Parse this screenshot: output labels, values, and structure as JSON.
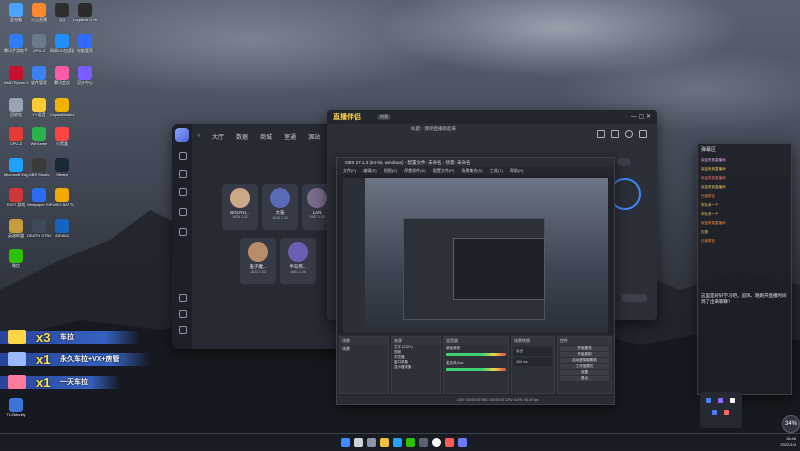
{
  "desktop_icons": [
    {
      "label": "此电脑",
      "color": "#4aa3ff"
    },
    {
      "label": "火山直播",
      "color": "#ff8a2b"
    },
    {
      "label": "QQ",
      "color": "#2f2f2f"
    },
    {
      "label": "Logitech G HUB",
      "color": "#2b2b2b"
    },
    {
      "label": "腾讯手游助手",
      "color": "#2e7cf6"
    },
    {
      "label": "GPU-Z",
      "color": "#6b7a8a"
    },
    {
      "label": "网易UU加速器",
      "color": "#1f8fff"
    },
    {
      "label": "电脑管家",
      "color": "#2f6bff"
    },
    {
      "label": "AMD Ryzen Master",
      "color": "#c8102e"
    },
    {
      "label": "软件管家",
      "color": "#3c82f6"
    },
    {
      "label": "腾讯会议",
      "color": "#ff5aa8"
    },
    {
      "label": "设计中心",
      "color": "#7b5cff"
    },
    {
      "label": "回收站",
      "color": "#9aa4b1"
    },
    {
      "label": "YY语音",
      "color": "#ffcc33"
    },
    {
      "label": "CrystalDiskInfo",
      "color": "#f0b400"
    },
    {
      "label": "CPU-Z",
      "color": "#e53935"
    },
    {
      "label": "WeGame",
      "color": "#2bb34b"
    },
    {
      "label": "小黑盒",
      "color": "#ff4444"
    },
    {
      "label": "Microsoft Edge",
      "color": "#1fa3ff"
    },
    {
      "label": "OBS Studio",
      "color": "#3a3a3a"
    },
    {
      "label": "Steam",
      "color": "#1b2838"
    },
    {
      "label": "RIOT 游戏",
      "color": "#d13639"
    },
    {
      "label": "Wallpaper Engine",
      "color": "#2a6df4"
    },
    {
      "label": "PUBG BATTLEGROUNDS",
      "color": "#f2a900"
    },
    {
      "label": "英雄联盟",
      "color": "#c89b3c"
    },
    {
      "label": "DEATH STRANDING",
      "color": "#3c4a5a"
    },
    {
      "label": "AIDA64",
      "color": "#1565c0"
    },
    {
      "label": "微信",
      "color": "#2dc100"
    },
    {
      "label": "TLSMunity",
      "color": "#3f74d9"
    }
  ],
  "app1": {
    "nav": [
      "大厅",
      "数据",
      "商城",
      "室通",
      "源站"
    ],
    "cards": [
      {
        "name": "BOUYU...",
        "stats": "1926 1.42"
      },
      {
        "name": "大笼",
        "stats": "1816 1.33"
      },
      {
        "name": "LAN",
        "stats": "1902 1.32"
      },
      {
        "name": "鬼子魔...",
        "stats": "1623 1.33"
      },
      {
        "name": "半岛熊...",
        "stats": "1681 1.26"
      }
    ]
  },
  "app2": {
    "brand": "直播伴侣",
    "version": "内测",
    "live_title": "标题：我吧直播跑起来"
  },
  "obs": {
    "title": "OBS 27.1.3 (64-bit, windows) - 配置文件: 未命名 - 场景: 未命名",
    "menu": [
      "文件(F)",
      "编辑(E)",
      "视图(V)",
      "停靠部件(D)",
      "配置文件(P)",
      "场景集合(S)",
      "工具(T)",
      "帮助(H)"
    ],
    "docks": [
      "场景",
      "来源",
      "混音器",
      "场景转换",
      "控件"
    ],
    "scene": "场景",
    "sources": [
      "文字 (GDI+)",
      "视频",
      "浏览器",
      "窗口采集",
      "显示器采集"
    ],
    "mixer_channels": [
      "桌面音频",
      "麦克风/Aux"
    ],
    "controls": [
      "开始推流",
      "开始录制",
      "启动虚拟摄像机",
      "工作室模式",
      "设置",
      "退出"
    ],
    "transition": "淡出",
    "duration": "300 ms",
    "status": "LIVE: 00:00:00   REC: 00:00:00   CPU: 6.6%, 60.00 fps"
  },
  "chat": {
    "header": "弹幕区",
    "rows": [
      {
        "text": "欢迎来到直播间",
        "color": "#f3a6ff"
      },
      {
        "text": "欢迎来到直播间",
        "color": "#ffce55"
      },
      {
        "text": "欢迎来到直播间",
        "color": "#ff7575"
      },
      {
        "text": "欢迎来到直播间",
        "color": "#ffce55"
      },
      {
        "text": "已被禁言",
        "color": "#ff8f3a"
      },
      {
        "text": "车队来一个",
        "color": "#ffce55"
      },
      {
        "text": "车队来一个",
        "color": "#ffce55"
      },
      {
        "text": "欢迎来到直播间",
        "color": "#ff8f3a"
      },
      {
        "text": "礼物",
        "color": "#ffce55"
      },
      {
        "text": "已被禁言",
        "color": "#ff8f3a"
      }
    ],
    "message": "这里是好好学习吧，追风、跑跑开直播时间到了出来聊聊！"
  },
  "banners": [
    {
      "count": "x3",
      "text": "车拉"
    },
    {
      "count": "x1",
      "text": "永久车拉+VX+房管"
    },
    {
      "count": "x1",
      "text": "一天车拉"
    }
  ],
  "tray": {
    "time": "16:48",
    "date": "2022/1/4"
  },
  "badge": "34%"
}
